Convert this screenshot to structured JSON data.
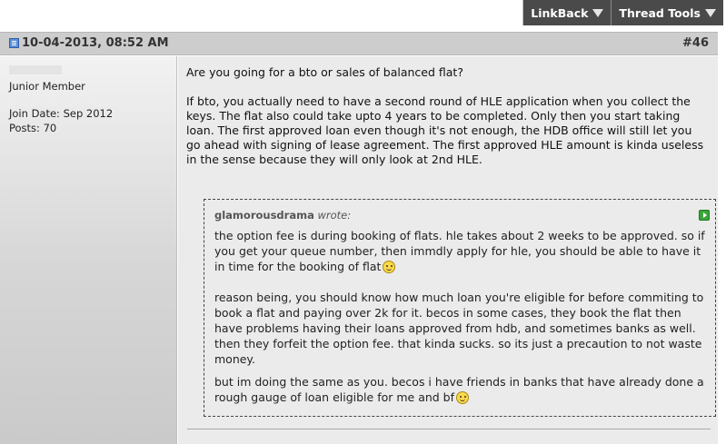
{
  "toolbar": {
    "linkback_label": "LinkBack",
    "thread_tools_label": "Thread Tools"
  },
  "post": {
    "date": "10-04-2013, 08:52 AM",
    "number": "#46"
  },
  "user": {
    "name": "",
    "title": "Junior Member",
    "join_date": "Join Date: Sep 2012",
    "posts": "Posts: 70"
  },
  "message": {
    "paragraphs": [
      "Are you going for a bto or sales of balanced flat?",
      "If bto, you actually need to have a second round of HLE application when you collect the keys. The flat also could take upto 4 years to be completed. Only then you start taking loan. The first approved loan even though it's not enough, the HDB office will still let you go ahead with signing of lease agreement. The first approved HLE amount is kinda useless in the sense because they will only look at 2nd HLE."
    ]
  },
  "quote": {
    "author": "glamorousdrama",
    "wrote": "wrote:",
    "paragraphs": [
      "the option fee is during booking of flats. hle takes about 2 weeks to be approved. so if you get your queue number, then immdly apply for hle, you should be able to have it in time for the booking of flat",
      "reason being, you should know how much loan you're eligible for before commiting to book a flat and paying over 2k for it. becos in some cases, they book the flat then have problems having their loans approved from hdb, and sometimes banks as well. then they forfeit the option fee. that kinda sucks. so its just a precaution to not waste money.",
      "but im doing the same as you. becos i have friends in banks that have already done a rough gauge of loan eligible for me and bf"
    ]
  },
  "icons": {
    "post_icon": "post-status-icon",
    "quote_link": "view-post-icon",
    "smiley": "smiley-icon"
  },
  "colors": {
    "toolbar_bg": "#4a4a4a",
    "header_bg": "#cdcdcd",
    "content_bg": "#ebebeb"
  }
}
